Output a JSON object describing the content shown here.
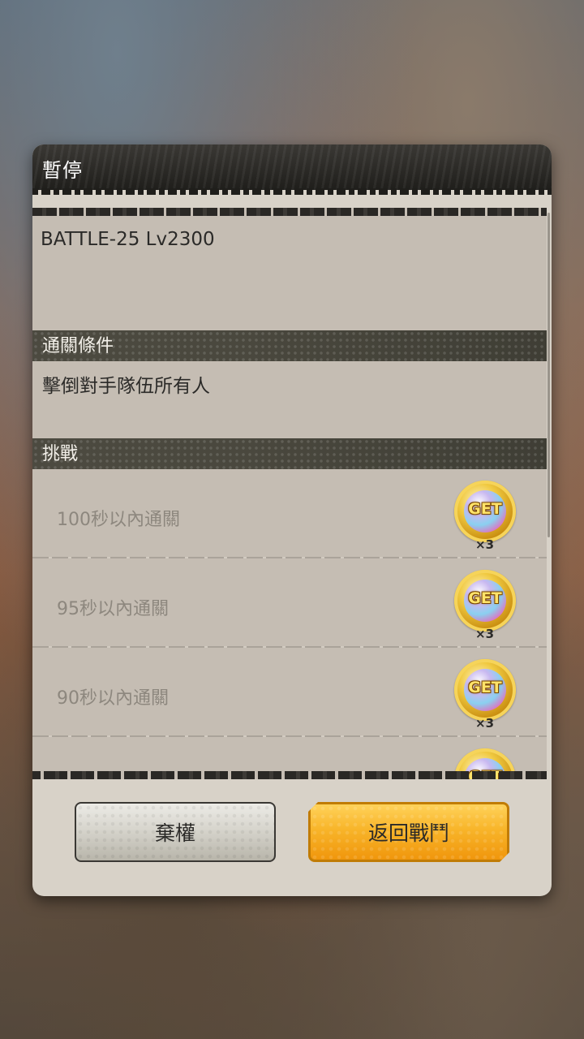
{
  "dialog": {
    "title": "暫停",
    "stage": "BATTLE-25 Lv2300",
    "clear_condition": {
      "header": "通關條件",
      "text": "擊倒對手隊伍所有人"
    },
    "challenge": {
      "header": "挑戰",
      "items": [
        {
          "label": "100秒以內通關",
          "reward_badge": "GET",
          "reward_count": "×3"
        },
        {
          "label": "95秒以內通關",
          "reward_badge": "GET",
          "reward_count": "×3"
        },
        {
          "label": "90秒以內通關",
          "reward_badge": "GET",
          "reward_count": "×3"
        },
        {
          "label": "",
          "reward_badge": "GET",
          "reward_count": ""
        }
      ]
    },
    "buttons": {
      "forfeit": "棄權",
      "return_to_battle": "返回戰鬥"
    }
  },
  "colors": {
    "section_header": "#4a483e",
    "accent_button": "#f8b52a",
    "medal_gold": "#f0c940"
  }
}
